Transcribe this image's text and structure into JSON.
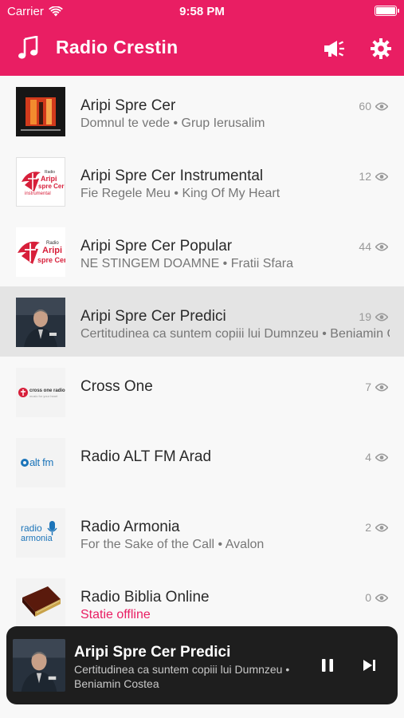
{
  "status_bar": {
    "carrier": "Carrier",
    "time": "9:58 PM"
  },
  "app_bar": {
    "title": "Radio Crestin",
    "icons": [
      "music-note-icon",
      "announcement-icon",
      "settings-icon"
    ]
  },
  "colors": {
    "accent": "#e91e63",
    "player_bg": "#1e1e1e",
    "selected_row": "#e4e4e4"
  },
  "stations": [
    {
      "name": "Aripi Spre Cer",
      "subtitle": "Domnul te vede • Grup Ierusalim",
      "listeners": "60",
      "thumb": "album-cover"
    },
    {
      "name": "Aripi Spre Cer Instrumental",
      "subtitle": "Fie Regele Meu • King Of My Heart",
      "listeners": "12",
      "thumb": "asc-logo-instrumental"
    },
    {
      "name": "Aripi Spre Cer Popular",
      "subtitle": "NE STINGEM DOAMNE • Fratii Sfara",
      "listeners": "44",
      "thumb": "asc-logo"
    },
    {
      "name": "Aripi Spre Cer Predici",
      "subtitle": "Certitudinea ca suntem copiii lui Dumnzeu • Beniamin Costea",
      "listeners": "19",
      "thumb": "preacher-photo",
      "selected": true
    },
    {
      "name": "Cross One",
      "subtitle": "",
      "listeners": "7",
      "thumb": "cross-one-logo"
    },
    {
      "name": "Radio ALT FM Arad",
      "subtitle": "",
      "listeners": "4",
      "thumb": "altfm-logo"
    },
    {
      "name": "Radio Armonia",
      "subtitle": "For the Sake of the Call • Avalon",
      "listeners": "2",
      "thumb": "armonia-logo"
    },
    {
      "name": "Radio Biblia Online",
      "subtitle": "Statie offline",
      "listeners": "0",
      "thumb": "bible-photo",
      "offline": true
    }
  ],
  "logos": {
    "asc_small": "Radio",
    "asc_line1": "Aripi",
    "asc_line2": "spre Cer",
    "asc_instr_line2": "spre Cer",
    "asc_instr_line3": "instrumental",
    "crossone": "cross one radio",
    "crossone_tag": "music for your heart",
    "altfm": "alt fm",
    "armonia_top": "radio",
    "armonia_bottom": "armonia",
    "album_top": "GRUP IERUSALIM"
  },
  "now_playing": {
    "title": "Aripi Spre Cer Predici",
    "subtitle": "Certitudinea ca suntem copiii lui Dumnzeu • Beniamin Costea",
    "state": "playing",
    "controls": [
      "pause-icon",
      "skip-next-icon"
    ]
  }
}
